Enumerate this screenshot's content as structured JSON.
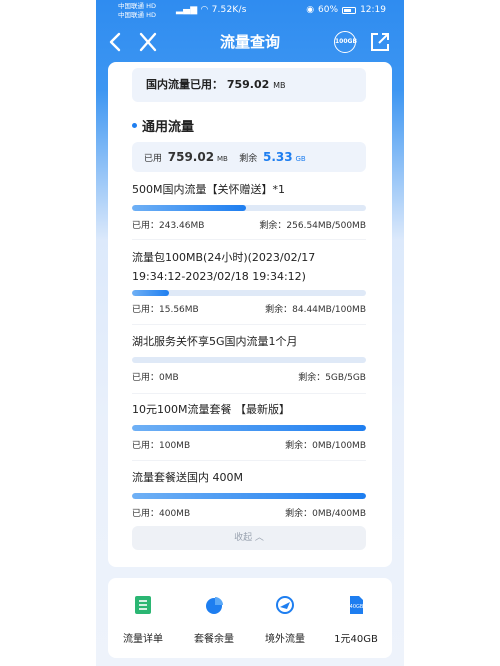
{
  "status_bar": {
    "carrier1": "中国联通 HD",
    "carrier2": "中国联通 HD",
    "speed": "7.52K/s",
    "battery": "60%",
    "time": "12:19"
  },
  "nav": {
    "title": "流量查询",
    "speed_badge": "100GB"
  },
  "summary": {
    "label": "国内流量已用：",
    "value": "759.02",
    "unit": "MB"
  },
  "general": {
    "title": "通用流量",
    "used_label": "已用",
    "used_value": "759.02",
    "used_unit": "MB",
    "remain_label": "剩余",
    "remain_value": "5.33",
    "remain_unit": "GB"
  },
  "packages": [
    {
      "name": "500M国内流量【关怀赠送】*1",
      "used": "已用：243.46MB",
      "remain": "剩余：256.54MB/500MB",
      "fraction": 0.487
    },
    {
      "name": "流量包100MB(24小时)(2023/02/17",
      "name2": "19:34:12-2023/02/18 19:34:12)",
      "used": "已用：15.56MB",
      "remain": "剩余：84.44MB/100MB",
      "fraction": 0.156
    },
    {
      "name": "湖北服务关怀享5G国内流量1个月",
      "used": "已用：0MB",
      "remain": "剩余：5GB/5GB",
      "fraction": 0.0
    },
    {
      "name": "10元100M流量套餐 【最新版】",
      "used": "已用：100MB",
      "remain": "剩余：0MB/100MB",
      "fraction": 1.0
    },
    {
      "name": "流量套餐送国内 400M",
      "used": "已用：400MB",
      "remain": "剩余：0MB/400MB",
      "fraction": 1.0
    }
  ],
  "collapse_label": "收起 ︿",
  "menu": [
    {
      "label": "流量详单",
      "icon": "list-icon",
      "color": "#2bb673"
    },
    {
      "label": "套餐余量",
      "icon": "pie-chart-icon",
      "color": "#1e7ef0"
    },
    {
      "label": "境外流量",
      "icon": "globe-plane-icon",
      "color": "#1e7ef0"
    },
    {
      "label": "1元40GB",
      "icon": "data-card-icon",
      "color": "#1e7ef0",
      "badge": "40GB"
    }
  ],
  "colors": {
    "accent": "#1e7ef0",
    "header_blue": "#2f8cf0"
  }
}
